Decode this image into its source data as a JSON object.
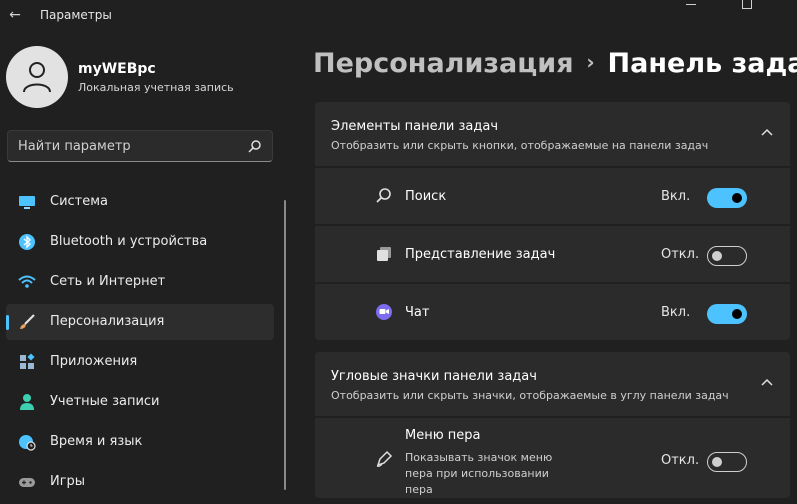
{
  "window": {
    "title": "Параметры",
    "back_icon": "arrow-left-icon",
    "controls": [
      "minimize-icon",
      "maximize-icon",
      "close-icon"
    ]
  },
  "profile": {
    "name": "myWEBpc",
    "subtitle": "Локальная учетная запись"
  },
  "search": {
    "placeholder": "Найти параметр",
    "icon": "search-icon"
  },
  "nav": {
    "items": [
      {
        "label": "Система",
        "icon": "monitor-icon",
        "color": "#4cc2ff"
      },
      {
        "label": "Bluetooth и устройства",
        "icon": "bluetooth-icon",
        "color": "#4cc2ff"
      },
      {
        "label": "Сеть и Интернет",
        "icon": "wifi-icon",
        "color": "#4cc2ff"
      },
      {
        "label": "Персонализация",
        "icon": "brush-icon",
        "color": "#e8a060",
        "active": true
      },
      {
        "label": "Приложения",
        "icon": "apps-icon",
        "color": "#9ab8d6"
      },
      {
        "label": "Учетные записи",
        "icon": "person-icon",
        "color": "#3ccfb0"
      },
      {
        "label": "Время и язык",
        "icon": "globe-clock-icon",
        "color": "#4cc2ff"
      },
      {
        "label": "Игры",
        "icon": "gamepad-icon",
        "color": "#9a9a9a"
      }
    ]
  },
  "breadcrumb": {
    "parent": "Персонализация",
    "separator": "›",
    "current": "Панель задач"
  },
  "section1": {
    "title": "Элементы панели задач",
    "subtitle": "Отобразить или скрыть кнопки, отображаемые на панели задач",
    "items": [
      {
        "label": "Поиск",
        "state": "Вкл.",
        "on": true,
        "icon": "search-icon"
      },
      {
        "label": "Представление задач",
        "state": "Откл.",
        "on": false,
        "icon": "task-view-icon"
      },
      {
        "label": "Чат",
        "state": "Вкл.",
        "on": true,
        "icon": "chat-icon"
      }
    ]
  },
  "section2": {
    "title": "Угловые значки панели задач",
    "subtitle": "Отобразить или скрыть значки, отображаемые в углу панели задач",
    "items": [
      {
        "label": "Меню пера",
        "description": "Показывать значок меню пера при использовании пера",
        "state": "Откл.",
        "on": false,
        "icon": "pen-icon"
      }
    ]
  },
  "colors": {
    "accent": "#4cc2ff",
    "background": "#202020",
    "card": "#2b2b2b"
  }
}
